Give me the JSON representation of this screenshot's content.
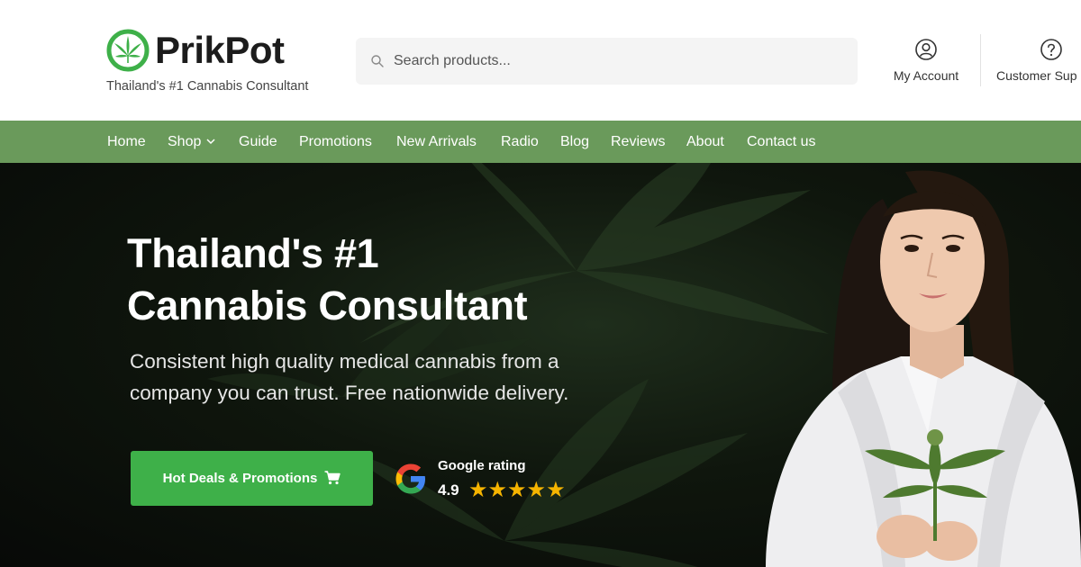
{
  "brand": {
    "name": "PrikPot",
    "tagline": "Thailand's #1 Cannabis Consultant",
    "color_green": "#3eb049"
  },
  "search": {
    "placeholder": "Search products..."
  },
  "header_links": {
    "account": "My Account",
    "support": "Customer Sup"
  },
  "nav": {
    "background": "#6a9a5b",
    "items": [
      "Home",
      "Shop",
      "Guide",
      "Promotions",
      "New Arrivals",
      "Radio",
      "Blog",
      "Reviews",
      "About",
      "Contact us"
    ]
  },
  "hero": {
    "title_line1": "Thailand's #1",
    "title_line2": "Cannabis Consultant",
    "subtitle": "Consistent high quality medical cannabis from a company you can trust. Free nationwide delivery.",
    "cta_label": "Hot Deals & Promotions",
    "cta_icon": "cart-icon"
  },
  "google_rating": {
    "label": "Google rating",
    "score": "4.9",
    "stars": 5,
    "icon": "google-logo-icon"
  }
}
